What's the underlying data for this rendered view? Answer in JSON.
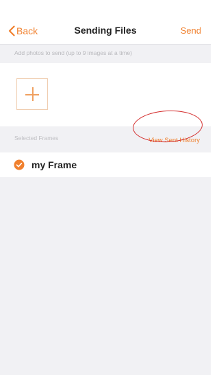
{
  "navbar": {
    "back_label": "Back",
    "title": "Sending Files",
    "send_label": "Send"
  },
  "hint": {
    "text": "Add photos to send (up to 9 images at a time)"
  },
  "frames": {
    "header_label": "Selected Frames",
    "view_history_label": "View Sent History",
    "items": [
      {
        "name": "my Frame",
        "selected": true
      }
    ]
  },
  "colors": {
    "accent": "#f0802e",
    "annotation": "#d32a2a",
    "section_bg": "#f1f1f4"
  }
}
